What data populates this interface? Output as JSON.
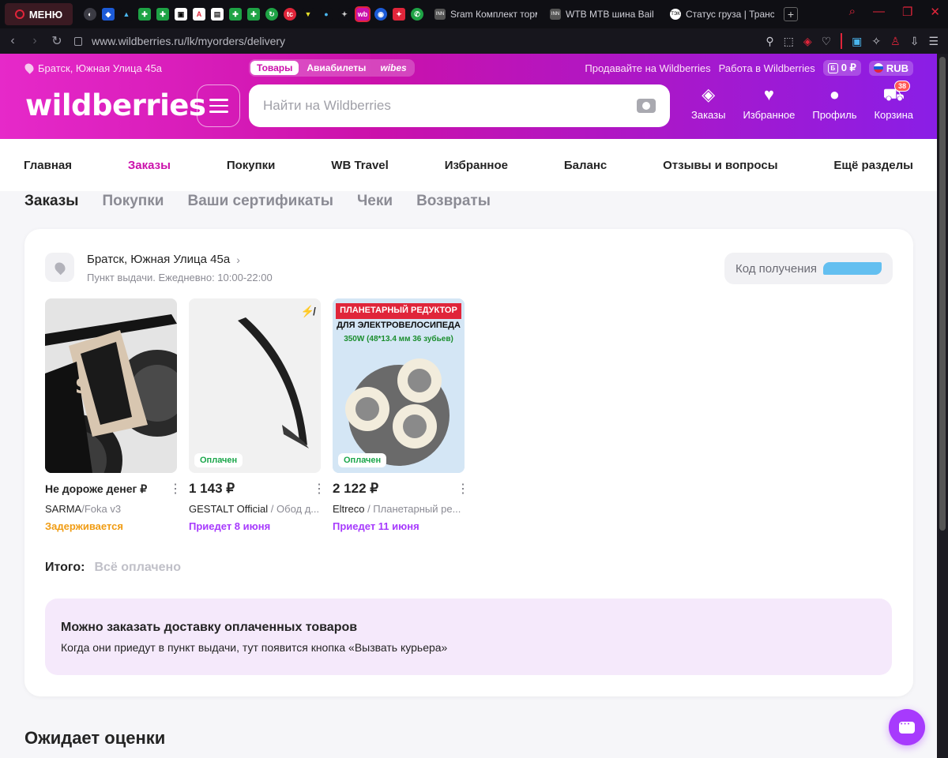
{
  "browser": {
    "menu_label": "МЕНЮ",
    "tabs": [
      {
        "title": "Sram Комплект торм",
        "icon": "INN"
      },
      {
        "title": "WTB MTB шина Bail",
        "icon": "INN"
      },
      {
        "title": "Статус груза | Транс",
        "icon": "ТЭК"
      }
    ],
    "url": "www.wildberries.ru/lk/myorders/delivery"
  },
  "header": {
    "location": "Братск, Южная Улица 45а",
    "switcher": [
      "Товары",
      "Авиабилеты",
      "wibes"
    ],
    "sell_link": "Продавайте на Wildberries",
    "work_link": "Работа в Wildberries",
    "balance": "0 ₽",
    "currency": "RUB",
    "logo": "wildberries",
    "search_placeholder": "Найти на Wildberries",
    "actions": {
      "orders": "Заказы",
      "favorites": "Избранное",
      "profile": "Профиль",
      "cart": "Корзина",
      "cart_count": "38"
    }
  },
  "main_nav": [
    "Главная",
    "Заказы",
    "Покупки",
    "WB Travel",
    "Избранное",
    "Баланс",
    "Отзывы и вопросы",
    "Ещё разделы"
  ],
  "sub_tabs": [
    "Заказы",
    "Покупки",
    "Ваши сертификаты",
    "Чеки",
    "Возвраты"
  ],
  "delivery": {
    "address": "Братск, Южная Улица 45а",
    "schedule": "Пункт выдачи. Ежедневно: 10:00-22:00",
    "code_label": "Код получения",
    "products": [
      {
        "price": "Не дороже денег ₽",
        "brand": "SARMA",
        "name": "/Foka v3",
        "status": "Задерживается",
        "tag": ""
      },
      {
        "price": "1 143 ₽",
        "brand": "GESTALT Official",
        "name": " / Обод д...",
        "status": "Приедет 8 июня",
        "tag": "Оплачен"
      },
      {
        "price": "2 122 ₽",
        "brand": "Eltreco",
        "name": " / Планетарный ре...",
        "status": "Приедет 11 июня",
        "tag": "Оплачен"
      }
    ],
    "product3_image_text": {
      "line1": "ПЛАНЕТАРНЫЙ РЕДУКТОР",
      "line2": "ДЛЯ ЭЛЕКТРОВЕЛОСИПЕДА",
      "line3": "350W (48*13.4 мм 36 зубьев)"
    },
    "total_label": "Итого:",
    "total_value": "Всё оплачено",
    "promo_title": "Можно заказать доставку оплаченных товаров",
    "promo_text": "Когда они приедут в пункт выдачи, тут появится кнопка «Вызвать курьера»"
  },
  "await_title": "Ожидает оценки",
  "colors": {
    "brand": "#cb11ab",
    "accent_purple": "#a73afd",
    "paid_green": "#1aa64a",
    "delay_orange": "#f09c13"
  }
}
